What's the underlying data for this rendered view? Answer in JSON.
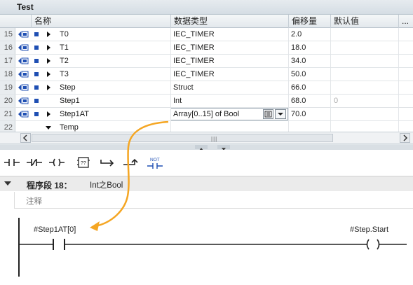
{
  "window": {
    "title": "Test"
  },
  "table": {
    "columns": [
      "名称",
      "数据类型",
      "偏移量",
      "默认值",
      "..."
    ],
    "rows": [
      {
        "num": "15",
        "name": "T0",
        "type": "IEC_TIMER",
        "offset": "2.0",
        "default": "",
        "expand": "right"
      },
      {
        "num": "16",
        "name": "T1",
        "type": "IEC_TIMER",
        "offset": "18.0",
        "default": "",
        "expand": "right"
      },
      {
        "num": "17",
        "name": "T2",
        "type": "IEC_TIMER",
        "offset": "34.0",
        "default": "",
        "expand": "right"
      },
      {
        "num": "18",
        "name": "T3",
        "type": "IEC_TIMER",
        "offset": "50.0",
        "default": "",
        "expand": "right"
      },
      {
        "num": "19",
        "name": "Step",
        "type": "Struct",
        "offset": "66.0",
        "default": "",
        "expand": "right"
      },
      {
        "num": "20",
        "name": "Step1",
        "type": "Int",
        "offset": "68.0",
        "default": "0",
        "expand": "none"
      },
      {
        "num": "21",
        "name": "Step1AT",
        "type": "Array[0..15] of Bool",
        "offset": "70.0",
        "default": "",
        "expand": "right"
      },
      {
        "num": "22",
        "name": "Temp",
        "type": "",
        "offset": "",
        "default": "",
        "expand": "down"
      }
    ]
  },
  "toolbar": {
    "buttons": [
      "no-contact",
      "nc-contact",
      "coil",
      "empty-box",
      "open-branch",
      "close-branch",
      "not-contact"
    ],
    "not_label": "NOT"
  },
  "network": {
    "label": "程序段 18：",
    "title": "Int之Bool",
    "comment_placeholder": "注释",
    "contact_operand": "#Step1AT[0]",
    "coil_operand": "#Step.Start"
  },
  "colors": {
    "annotation_arrow": "#f5a623",
    "io_icon": "#1f4fb3"
  }
}
